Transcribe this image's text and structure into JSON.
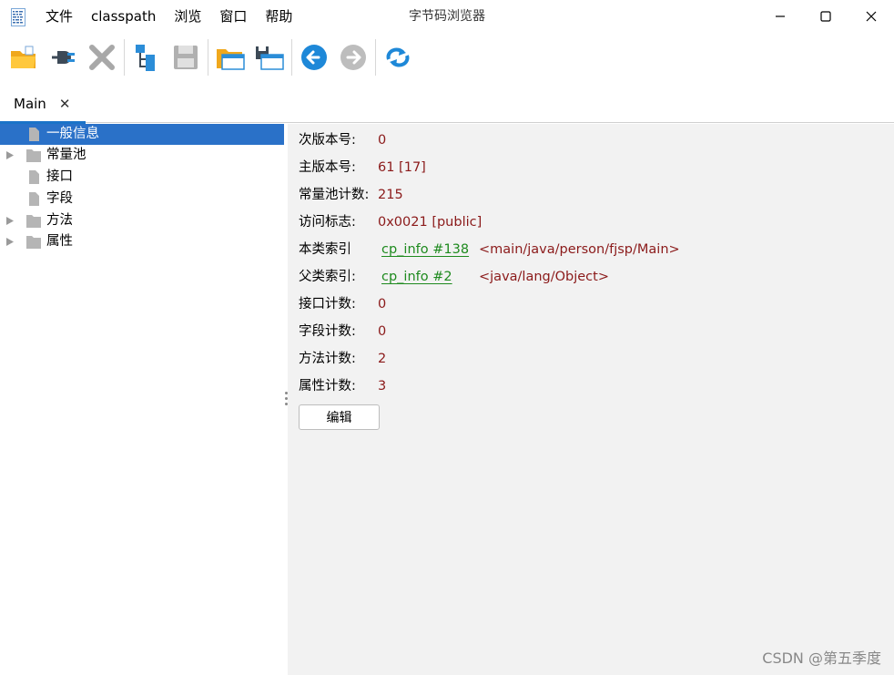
{
  "window": {
    "title": "字节码浏览器",
    "menu": [
      "文件",
      "classpath",
      "浏览",
      "窗口",
      "帮助"
    ]
  },
  "toolbar": {
    "buttons": [
      {
        "icon": "open-folder-icon",
        "enabled": true
      },
      {
        "icon": "plug-icon",
        "enabled": true
      },
      {
        "icon": "close-x-icon",
        "enabled": false
      },
      {
        "icon": "tree-structure-icon",
        "enabled": true
      },
      {
        "icon": "save-icon",
        "enabled": false
      },
      {
        "icon": "open-window-icon",
        "enabled": true
      },
      {
        "icon": "save-window-icon",
        "enabled": true
      },
      {
        "icon": "back-arrow-icon",
        "enabled": true
      },
      {
        "icon": "forward-arrow-icon",
        "enabled": false
      },
      {
        "icon": "refresh-icon",
        "enabled": true
      }
    ]
  },
  "tab": {
    "label": "Main",
    "close": "✕"
  },
  "tree": {
    "items": [
      {
        "label": "一般信息",
        "type": "file",
        "expandable": false,
        "selected": true
      },
      {
        "label": "常量池",
        "type": "folder",
        "expandable": true,
        "selected": false
      },
      {
        "label": "接口",
        "type": "file",
        "expandable": false,
        "selected": false
      },
      {
        "label": "字段",
        "type": "file",
        "expandable": false,
        "selected": false
      },
      {
        "label": "方法",
        "type": "folder",
        "expandable": true,
        "selected": false
      },
      {
        "label": "属性",
        "type": "folder",
        "expandable": true,
        "selected": false
      }
    ]
  },
  "info": {
    "minor_version": {
      "label": "次版本号:",
      "value": "0"
    },
    "major_version": {
      "label": "主版本号:",
      "value": "61 [17]"
    },
    "constant_pool_count": {
      "label": "常量池计数:",
      "value": "215"
    },
    "access_flags": {
      "label": "访问标志:",
      "value": "0x0021 [public]"
    },
    "this_class": {
      "label": "本类索引",
      "link": "cp_info #138",
      "desc": "<main/java/person/fjsp/Main>"
    },
    "super_class": {
      "label": "父类索引:",
      "link": "cp_info #2",
      "desc": "<java/lang/Object>"
    },
    "interfaces_count": {
      "label": "接口计数:",
      "value": "0"
    },
    "fields_count": {
      "label": "字段计数:",
      "value": "0"
    },
    "methods_count": {
      "label": "方法计数:",
      "value": "2"
    },
    "attributes_count": {
      "label": "属性计数:",
      "value": "3"
    },
    "edit_button": "编辑"
  },
  "watermark": "CSDN @第五季度",
  "colors": {
    "selection": "#2a71c8",
    "value": "#8b1a1a",
    "link": "#1e8a1e",
    "accent": "#1a73c8"
  }
}
